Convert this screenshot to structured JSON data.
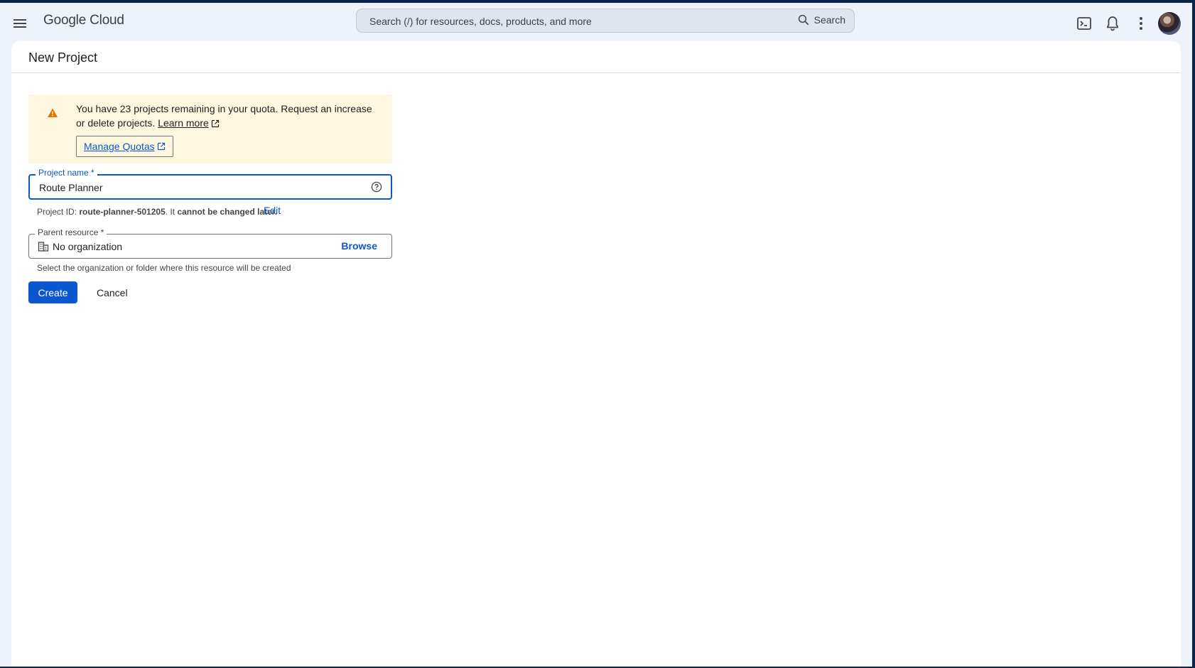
{
  "header": {
    "menu_icon": "hamburger-menu-icon",
    "logo": "Google Cloud",
    "search": {
      "placeholder": "Search (/) for resources, docs, products, and more",
      "button_label": "Search"
    },
    "icons": [
      "terminal-icon",
      "bell-icon",
      "more-vert-icon"
    ]
  },
  "page": {
    "title": "New Project"
  },
  "warning": {
    "text": "You have 23 projects remaining in your quota. Request an increase or delete projects.",
    "learn_more": "Learn more",
    "manage_quotas": "Manage Quotas"
  },
  "form": {
    "project_name": {
      "label": "Project name *",
      "value": "Route Planner"
    },
    "project_id": {
      "prefix": "Project ID:",
      "id": "route-planner-501205",
      "suffix_plain": ". It",
      "suffix_bold": "cannot be changed later.",
      "edit_label": "Edit"
    },
    "parent_resource": {
      "label": "Parent resource *",
      "value": "No organization",
      "browse_label": "Browse",
      "hint": "Select the organization or folder where this resource will be created"
    }
  },
  "actions": {
    "create": "Create",
    "cancel": "Cancel"
  },
  "colors": {
    "accent": "#0b57d0",
    "warning_bg": "#fef7e0",
    "warning_icon": "#e37400"
  }
}
